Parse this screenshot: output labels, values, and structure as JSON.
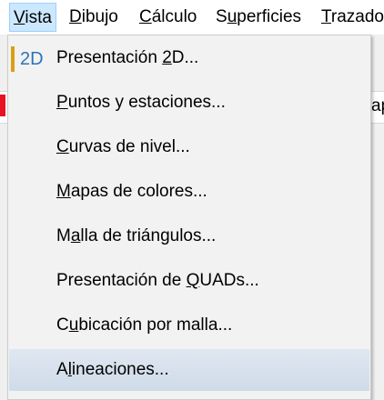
{
  "menubar": {
    "items": [
      {
        "pre": "",
        "ul": "V",
        "post": "ista"
      },
      {
        "pre": "",
        "ul": "D",
        "post": "ibujo"
      },
      {
        "pre": "",
        "ul": "C",
        "post": "álculo"
      },
      {
        "pre": "S",
        "ul": "u",
        "post": "perficies"
      },
      {
        "pre": "",
        "ul": "T",
        "post": "razado"
      }
    ]
  },
  "background": {
    "partial_text": "ap"
  },
  "menu": {
    "icon_text": "2D",
    "items": [
      {
        "pre": "Presentación ",
        "ul": "2",
        "post": "D..."
      },
      {
        "pre": "",
        "ul": "P",
        "post": "untos y estaciones..."
      },
      {
        "pre": "",
        "ul": "C",
        "post": "urvas de nivel..."
      },
      {
        "pre": "",
        "ul": "M",
        "post": "apas de colores..."
      },
      {
        "pre": "M",
        "ul": "a",
        "post": "lla de triángulos..."
      },
      {
        "pre": "Presentación de ",
        "ul": "Q",
        "post": "UADs..."
      },
      {
        "pre": "C",
        "ul": "u",
        "post": "bicación por malla..."
      },
      {
        "pre": "A",
        "ul": "l",
        "post": "ineaciones..."
      }
    ]
  },
  "colors": {
    "icon_accent": "#d9a016",
    "icon_text": "#2b74b8",
    "hover": "#cfdbe9",
    "active_menu": "#cce8ff"
  }
}
